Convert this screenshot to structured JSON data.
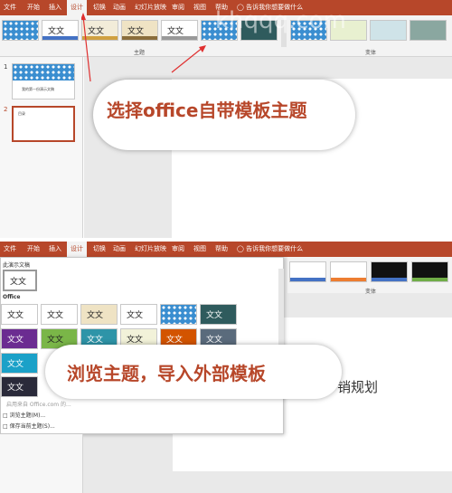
{
  "top": {
    "tabs": [
      "文件",
      "开始",
      "插入",
      "设计",
      "切换",
      "动画",
      "幻灯片放映",
      "审阅",
      "视图",
      "帮助"
    ],
    "active_tab": "设计",
    "tell_me": "告诉我你想要做什么",
    "theme_group_label": "主题",
    "variant_group_label": "变体",
    "thumb_text": "文文",
    "slide_numbers": [
      "1",
      "2"
    ],
    "slide1_title": "我的第一份演示文稿",
    "slide2_title": "目录",
    "callout": "选择office自带模板主题",
    "watermark": "khqqq.com"
  },
  "bottom": {
    "tabs": [
      "文件",
      "开始",
      "插入",
      "设计",
      "切换",
      "动画",
      "幻灯片放映",
      "审阅",
      "视图",
      "帮助"
    ],
    "active_tab": "设计",
    "tell_me": "告诉我你想要做什么",
    "current_section": "此演示文稿",
    "office_section": "Office",
    "thumb_text": "文文",
    "variant_group_label": "变体",
    "online_hint": "启用来自 Office.com 的...",
    "browse_label": "浏览主题(M)...",
    "save_label": "保存当前主题(S)...",
    "callout": "浏览主题，导入外部模板",
    "slide_text": "销规划"
  },
  "colors": {
    "accent": "#b7472a",
    "ribbon": "#f3f3f3",
    "workspace": "#e9e9e9"
  }
}
